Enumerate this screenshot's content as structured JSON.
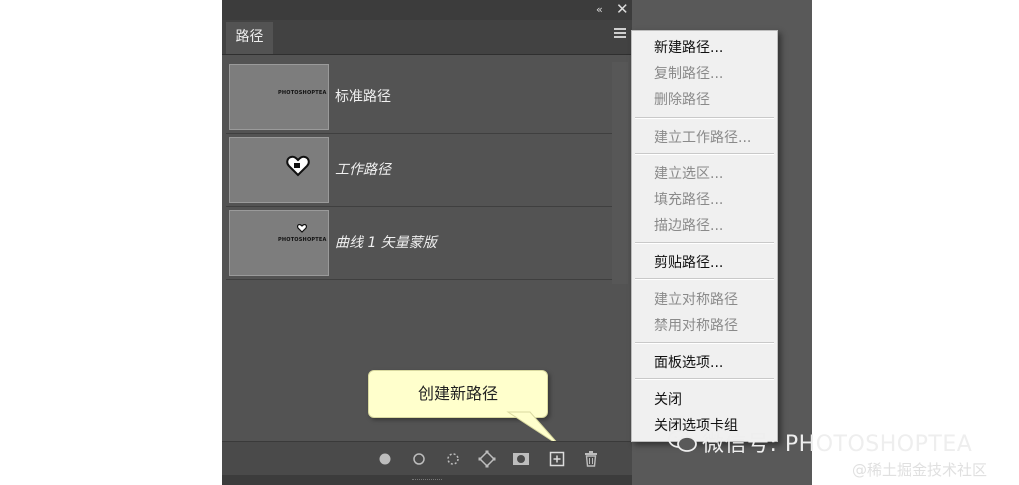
{
  "panel": {
    "tab_label": "路径",
    "collapse_glyph": "‹‹",
    "close_glyph": "✕",
    "rows": [
      {
        "label": "标准路径",
        "thumbnail_text": "PHOTOSHOPTEA",
        "italic": false
      },
      {
        "label": "工作路径",
        "thumbnail_text": "",
        "italic": true
      },
      {
        "label": "曲线 1 矢量蒙版",
        "thumbnail_text": "PHOTOSHOPTEA",
        "italic": true
      }
    ],
    "tooltip": "创建新路径",
    "bottom_icons": [
      "fill-path-icon",
      "stroke-path-icon",
      "load-selection-icon",
      "make-work-path-icon",
      "add-mask-icon",
      "new-path-icon",
      "delete-path-icon"
    ]
  },
  "menu": {
    "items": [
      {
        "label": "新建路径...",
        "disabled": false
      },
      {
        "label": "复制路径...",
        "disabled": true
      },
      {
        "label": "删除路径",
        "disabled": true
      },
      {
        "label": "建立工作路径...",
        "disabled": true
      },
      {
        "label": "建立选区...",
        "disabled": true
      },
      {
        "label": "填充路径...",
        "disabled": true
      },
      {
        "label": "描边路径...",
        "disabled": true
      },
      {
        "label": "剪贴路径...",
        "disabled": false
      },
      {
        "label": "建立对称路径",
        "disabled": true
      },
      {
        "label": "禁用对称路径",
        "disabled": true
      },
      {
        "label": "面板选项...",
        "disabled": false
      },
      {
        "label": "关闭",
        "disabled": false
      },
      {
        "label": "关闭选项卡组",
        "disabled": false
      }
    ]
  },
  "watermark": {
    "text": "微信号: PHOTOSHOPTEA",
    "credit": "@稀土掘金技术社区"
  },
  "colors": {
    "panel_bg": "#535353",
    "tooltip_bg": "#ffffcc",
    "menu_bg": "#f0f0f0"
  }
}
